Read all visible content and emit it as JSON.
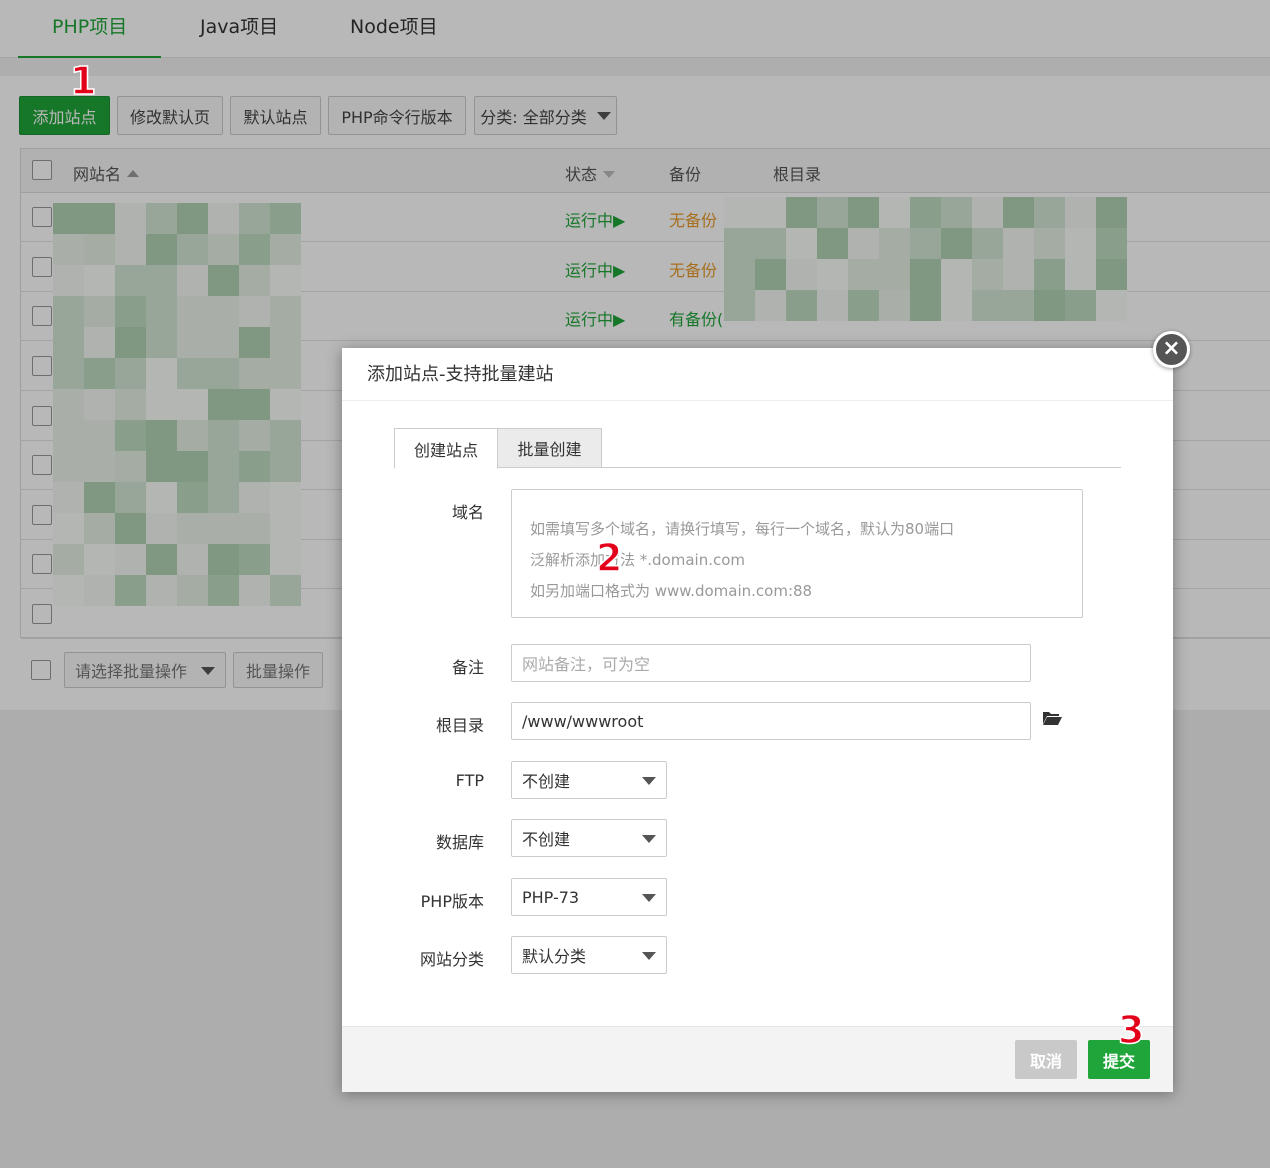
{
  "tabs": [
    "PHP项目",
    "Java项目",
    "Node项目"
  ],
  "toolbar": {
    "add_site": "添加站点",
    "edit_default_page": "修改默认页",
    "default_site": "默认站点",
    "php_cli_version": "PHP命令行版本",
    "category": "分类: 全部分类"
  },
  "table": {
    "headers": {
      "site_name": "网站名",
      "status": "状态",
      "backup": "备份",
      "root": "根目录"
    },
    "rows": [
      {
        "status": "运行中▶",
        "backup": "无备份"
      },
      {
        "status": "运行中▶",
        "backup": "无备份"
      },
      {
        "status": "运行中▶",
        "backup": "有备份("
      }
    ]
  },
  "bottom": {
    "batch_select": "请选择批量操作",
    "batch_action": "批量操作"
  },
  "steps": [
    "1",
    "2",
    "3"
  ],
  "modal": {
    "title": "添加站点-支持批量建站",
    "close": "×",
    "tabs": [
      "创建站点",
      "批量创建"
    ],
    "domain": {
      "label": "域名",
      "placeholder_lines": [
        "如需填写多个域名，请换行填写，每行一个域名，默认为80端口",
        "泛解析添加方法 *.domain.com",
        "如另加端口格式为 www.domain.com:88"
      ]
    },
    "remark": {
      "label": "备注",
      "placeholder": "网站备注，可为空"
    },
    "root": {
      "label": "根目录",
      "value": "/www/wwwroot"
    },
    "ftp": {
      "label": "FTP",
      "value": "不创建"
    },
    "database": {
      "label": "数据库",
      "value": "不创建"
    },
    "php_version": {
      "label": "PHP版本",
      "value": "PHP-73"
    },
    "site_category": {
      "label": "网站分类",
      "value": "默认分类"
    },
    "cancel": "取消",
    "submit": "提交"
  },
  "colors": {
    "accent": "#20a53a",
    "warning": "#e89a2c",
    "step": "#e3001b"
  }
}
